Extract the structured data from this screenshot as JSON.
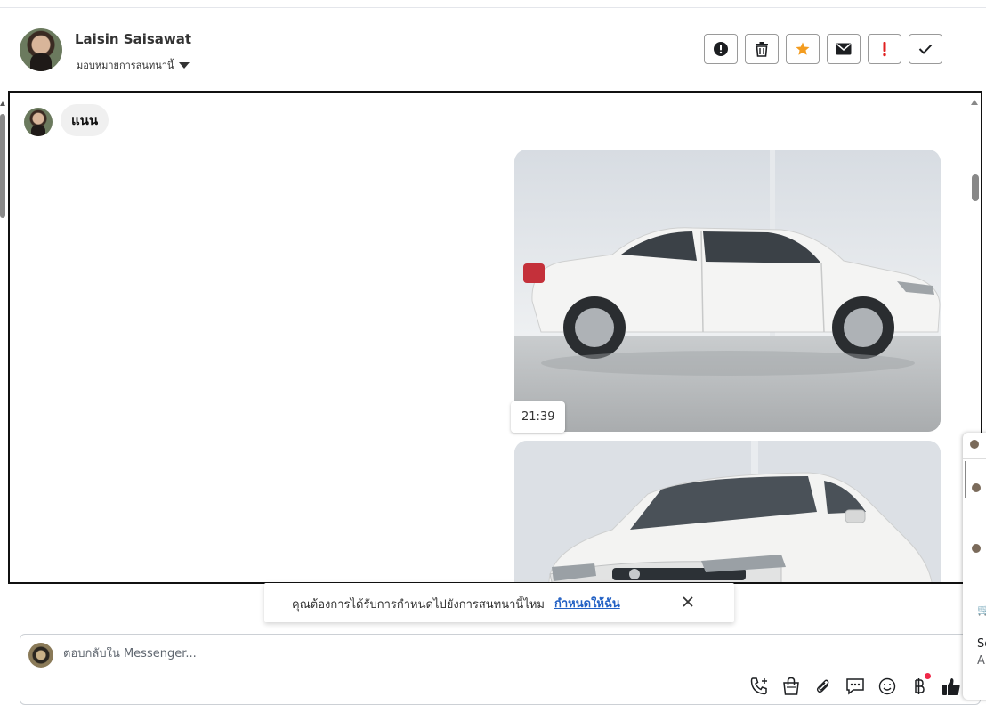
{
  "header": {
    "contact_name": "Laisin Saisawat",
    "assign_label": "มอบหมายการสนทนานี้",
    "actions": [
      {
        "name": "report-icon",
        "label": "!"
      },
      {
        "name": "trash-icon",
        "label": "delete"
      },
      {
        "name": "star-icon",
        "label": "star"
      },
      {
        "name": "mail-icon",
        "label": "mail"
      },
      {
        "name": "exclamation-icon",
        "label": "!"
      },
      {
        "name": "check-icon",
        "label": "done"
      }
    ]
  },
  "conversation": {
    "message_text": "แนน",
    "timestamp": "21:39"
  },
  "toast": {
    "text": "คุณต้องการได้รับการกำหนดไปยังการสนทนานี้ไหม",
    "link": "กำหนดให้ฉัน"
  },
  "composer": {
    "placeholder": "ตอบกลับใน Messenger..."
  },
  "side_panel": {
    "line1": "So",
    "line2": "A"
  },
  "colors": {
    "accent_link": "#2160c4",
    "star": "#f39c1f",
    "alert": "#e02020",
    "notification_dot": "#f02849"
  }
}
